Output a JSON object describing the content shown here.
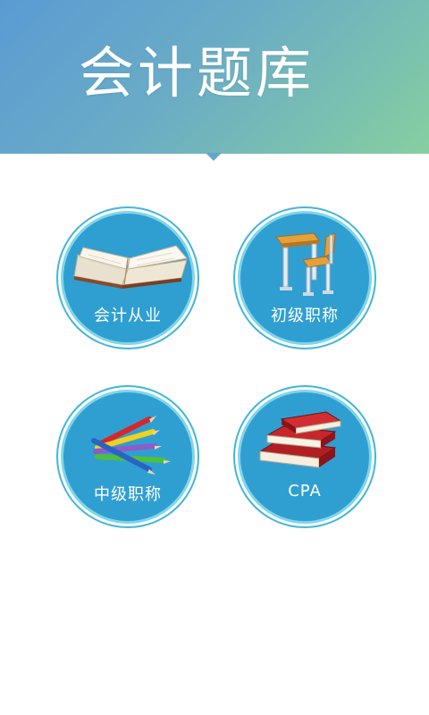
{
  "header": {
    "title": "会计题库"
  },
  "categories": [
    {
      "label": "会计从业",
      "icon": "open-book-icon"
    },
    {
      "label": "初级职称",
      "icon": "school-desk-icon"
    },
    {
      "label": "中级职称",
      "icon": "colored-pencils-icon"
    },
    {
      "label": "CPA",
      "icon": "stacked-books-icon"
    }
  ],
  "colors": {
    "header_gradient_start": "#5a9bd3",
    "header_gradient_end": "#86cfa0",
    "tile_fill": "#2f9fd2",
    "tile_ring": "#42b6d8"
  }
}
